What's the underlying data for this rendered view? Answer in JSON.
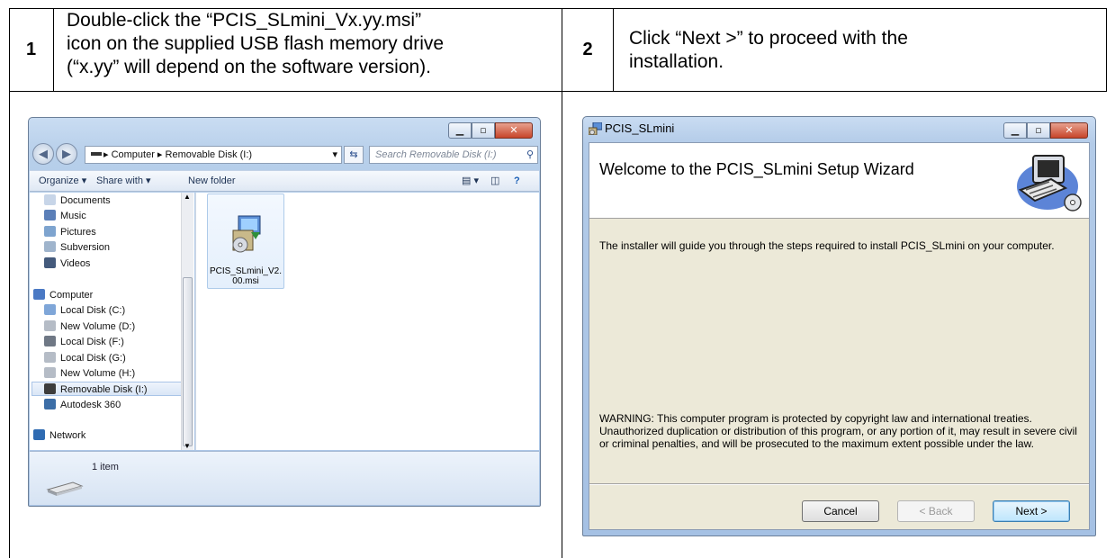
{
  "steps": [
    {
      "number": "1",
      "lines": [
        "Double-click the “PCIS_SLmini_Vx.yy.msi”",
        "icon on the supplied USB flash memory drive",
        "(“x.yy” will depend on the software version)."
      ]
    },
    {
      "number": "2",
      "lines": [
        "Click “Next >” to proceed with the",
        "installation."
      ]
    }
  ],
  "explorer": {
    "address": "▸ Computer ▸ Removable Disk (I:) ",
    "search_placeholder": "Search Removable Disk (I:)",
    "toolbar": {
      "organize": "Organize ▾",
      "share_with": "Share with ▾",
      "new_folder": "New folder"
    },
    "nav_items": [
      {
        "label": "Documents",
        "icon": "documents-icon",
        "color": "#c7d5e8"
      },
      {
        "label": "Music",
        "icon": "music-icon",
        "color": "#5b7fb8"
      },
      {
        "label": "Pictures",
        "icon": "pictures-icon",
        "color": "#7ea4cf"
      },
      {
        "label": "Subversion",
        "icon": "subversion-icon",
        "color": "#9fb4cc"
      },
      {
        "label": "Videos",
        "icon": "videos-icon",
        "color": "#445a7c"
      },
      {
        "label": "Computer",
        "icon": "computer-icon",
        "color": "#4a79c4"
      },
      {
        "label": "Local Disk (C:)",
        "icon": "windows-disk-icon",
        "color": "#7fa6d8"
      },
      {
        "label": "New Volume (D:)",
        "icon": "drive-icon",
        "color": "#b5bcc6"
      },
      {
        "label": "Local Disk (F:)",
        "icon": "drive-icon",
        "color": "#6f7885"
      },
      {
        "label": "Local Disk (G:)",
        "icon": "drive-icon",
        "color": "#b5bcc6"
      },
      {
        "label": "New Volume (H:)",
        "icon": "drive-icon",
        "color": "#b5bcc6"
      },
      {
        "label": "Removable Disk (I:)",
        "icon": "usb-drive-icon",
        "color": "#3d3d3d"
      },
      {
        "label": "Autodesk 360",
        "icon": "autodesk-icon",
        "color": "#3c6ea7"
      },
      {
        "label": "Network",
        "icon": "network-icon",
        "color": "#2f6bb2"
      }
    ],
    "file": {
      "name": "PCIS_SLmini_V2.00.msi",
      "icon": "msi-installer-icon"
    },
    "status": "1 item"
  },
  "installer": {
    "title": "PCIS_SLmini",
    "heading": "Welcome to the PCIS_SLmini Setup Wizard",
    "intro": "The installer will guide you through the steps required to install PCIS_SLmini on your computer.",
    "warning_lines": [
      "WARNING: This computer program is protected by copyright law and international treaties.",
      "Unauthorized duplication or distribution of this program, or any portion of it, may result in severe civil",
      "or criminal penalties, and will be prosecuted to the maximum extent possible under the law."
    ],
    "buttons": {
      "cancel": "Cancel",
      "back": "< Back",
      "next": "Next >"
    }
  }
}
